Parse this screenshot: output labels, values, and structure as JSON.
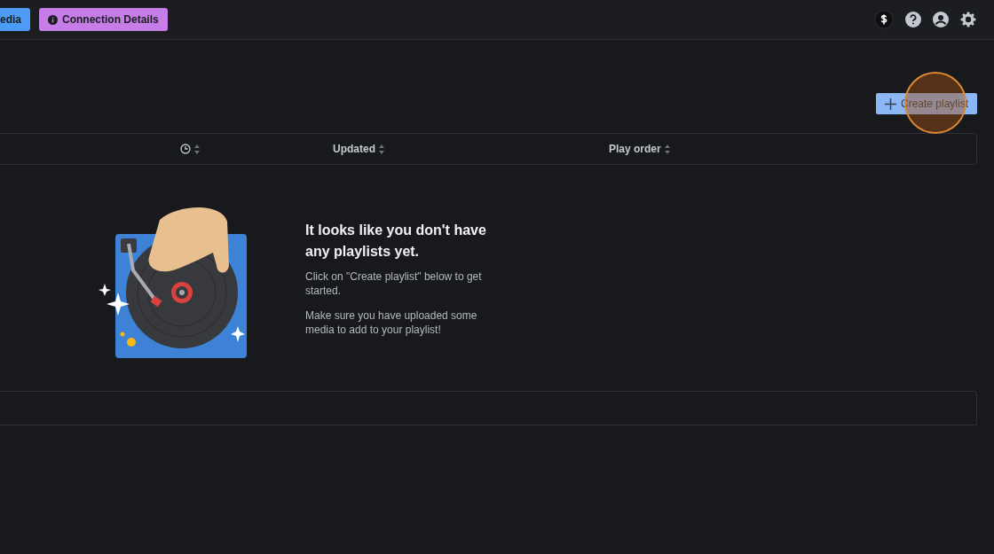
{
  "toolbar": {
    "buttons": [
      {
        "label": "edia",
        "kind": "media"
      },
      {
        "label": "Connection Details",
        "kind": "connection"
      }
    ]
  },
  "create_button": {
    "label": "Create playlist"
  },
  "table": {
    "columns": [
      {
        "kind": "icon"
      },
      {
        "kind": "text",
        "label": "Updated"
      },
      {
        "kind": "text",
        "label": "Play order"
      }
    ]
  },
  "empty_state": {
    "title": "It looks like you don't have any playlists yet.",
    "paragraphs": [
      "Click on \"Create playlist\" below to get started.",
      "Make sure you have uploaded some media to add to your playlist!"
    ]
  }
}
